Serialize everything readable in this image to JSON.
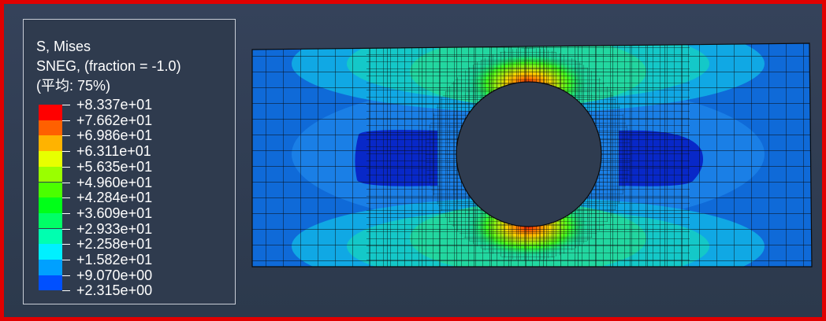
{
  "legend": {
    "variable": "S, Mises",
    "option": "SNEG, (fraction = -1.0)",
    "average": "(平均: 75%)",
    "values": [
      "+8.337e+01",
      "+7.662e+01",
      "+6.986e+01",
      "+6.311e+01",
      "+5.635e+01",
      "+4.960e+01",
      "+4.284e+01",
      "+3.609e+01",
      "+2.933e+01",
      "+2.258e+01",
      "+1.582e+01",
      "+9.070e+00",
      "+2.315e+00"
    ],
    "colors": [
      "#ff0000",
      "#ff6000",
      "#ffb300",
      "#e7ff00",
      "#9aff00",
      "#4aff00",
      "#00ff18",
      "#00ff66",
      "#00ffb0",
      "#00f0ff",
      "#00a0ff",
      "#0050ff",
      "#0000ff"
    ]
  },
  "colors": {
    "frame_border": "#e00000",
    "background": "#2f3c50",
    "mesh_line": "#0a0a0a"
  }
}
